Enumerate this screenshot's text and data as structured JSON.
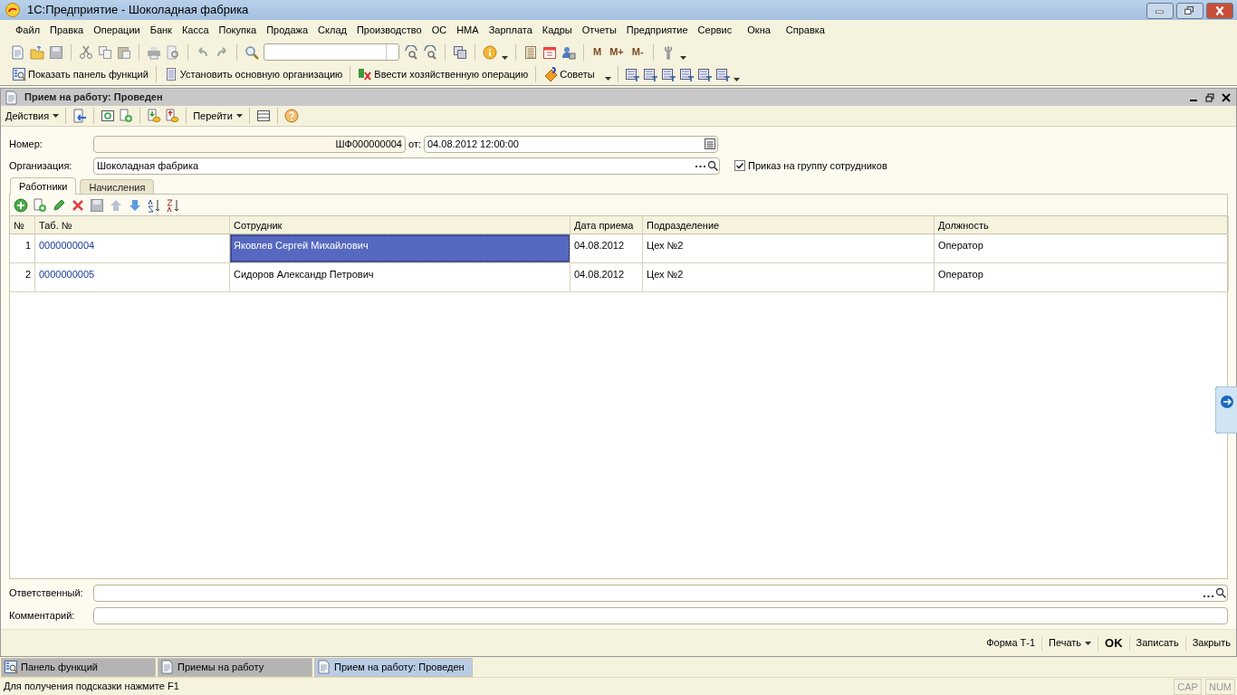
{
  "window": {
    "title": "1С:Предприятие - Шоколадная фабрика"
  },
  "menu": [
    "Файл",
    "Правка",
    "Операции",
    "Банк",
    "Касса",
    "Покупка",
    "Продажа",
    "Склад",
    "Производство",
    "ОС",
    "НМА",
    "Зарплата",
    "Кадры",
    "Отчеты",
    "Предприятие",
    "Сервис",
    "Окна",
    "Справка"
  ],
  "toolbar": {
    "memory_buttons": [
      "M",
      "M+",
      "M-"
    ]
  },
  "function_toolbar": [
    {
      "label": "Показать панель функций",
      "kind": "panel"
    },
    {
      "label": "Установить основную организацию",
      "kind": "org"
    },
    {
      "label": "Ввести хозяйственную операцию",
      "kind": "operation"
    },
    {
      "label": "Советы",
      "kind": "tips"
    }
  ],
  "document": {
    "title": "Прием на работу: Проведен",
    "actions": [
      {
        "label": "Действия"
      },
      {
        "label": "Перейти"
      }
    ],
    "number": {
      "label": "Номер:",
      "value": "ШФ000000004",
      "date_label": "от:",
      "date": "04.08.2012 12:00:00"
    },
    "organization": {
      "label": "Организация:",
      "value": "Шоколадная фабрика"
    },
    "group_order": {
      "label": "Приказ на группу сотрудников",
      "checked": true
    },
    "tabs": [
      {
        "label": "Работники",
        "selected": true
      },
      {
        "label": "Начисления",
        "selected": false
      }
    ],
    "table": {
      "columns": [
        "№",
        "Таб. №",
        "Сотрудник",
        "Дата приема",
        "Подразделение",
        "Должность"
      ],
      "rows": [
        {
          "cells": [
            "1",
            "0000000004",
            "Яковлев Сергей Михайлович",
            "04.08.2012",
            "Цех №2",
            "Оператор"
          ],
          "selected": true
        },
        {
          "cells": [
            "2",
            "0000000005",
            "Сидоров Александр Петрович",
            "04.08.2012",
            "Цех №2",
            "Оператор"
          ],
          "selected": false
        }
      ]
    },
    "responsible": {
      "label": "Ответственный:"
    },
    "comment": {
      "label": "Комментарий:"
    },
    "buttons": [
      {
        "label": "Форма Т-1",
        "kind": "plain"
      },
      {
        "label": "Печать",
        "kind": "menu"
      },
      {
        "label": "OK",
        "kind": "default"
      },
      {
        "label": "Записать",
        "kind": "plain"
      },
      {
        "label": "Закрыть",
        "kind": "plain"
      }
    ]
  },
  "taskbar": [
    {
      "label": "Панель функций",
      "kind": "panel",
      "selected": false
    },
    {
      "label": "Приемы на работу",
      "kind": "doc",
      "selected": false
    },
    {
      "label": "Прием на работу: Проведен",
      "kind": "doc",
      "selected": true
    }
  ],
  "status_bar": {
    "hint": "Для получения подсказки нажмите F1",
    "indicators": [
      "CAP",
      "NUM"
    ]
  }
}
